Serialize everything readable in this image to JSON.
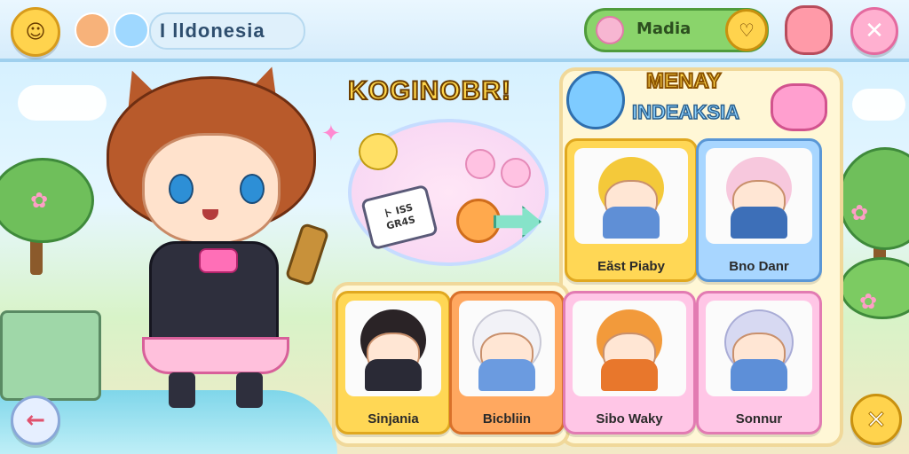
{
  "header": {
    "title": "I lldonesia",
    "media_label": "Madia",
    "menu_icon": "menu-face-icon",
    "media_icon_left": "pink-bear-icon",
    "media_icon_right": "heart-icon",
    "close_icon": "close-icon",
    "bear_avatar": "bear-mascot-icon"
  },
  "stage": {
    "headline": "KOGINOBR!",
    "speech_text": "ト ISS\nGR4S"
  },
  "panel": {
    "title_line1": "MENAY",
    "title_line2": "INDEAKSIA",
    "cards": [
      {
        "label": "Eăst Piaby",
        "hair": "#f4c93a",
        "bg": "#ffe78a",
        "body": "#5f8fd6"
      },
      {
        "label": "Bno Danr",
        "hair": "#f7c8dd",
        "bg": "#bfe3ff",
        "body": "#3d6fb8"
      },
      {
        "label": "Sinjania",
        "hair": "#2a2326",
        "bg": "#ffe78a",
        "body": "#2a2a36"
      },
      {
        "label": "Bicbliin",
        "hair": "#f2f2f7",
        "bg": "#ffb26b",
        "body": "#6b9be0"
      },
      {
        "label": "Sibo Waky",
        "hair": "#f29a3b",
        "bg": "#ffd3ec",
        "body": "#e8772c"
      },
      {
        "label": "Sonnur",
        "hair": "#d7d9f2",
        "bg": "#ffd3ec",
        "body": "#5d8fd8"
      }
    ]
  },
  "controls": {
    "back_icon": "back-arrow-icon",
    "close_icon": "close-icon"
  },
  "colors": {
    "accent_yellow": "#ffd34d",
    "accent_pink": "#ffb0d0",
    "accent_green": "#8ad46b"
  }
}
